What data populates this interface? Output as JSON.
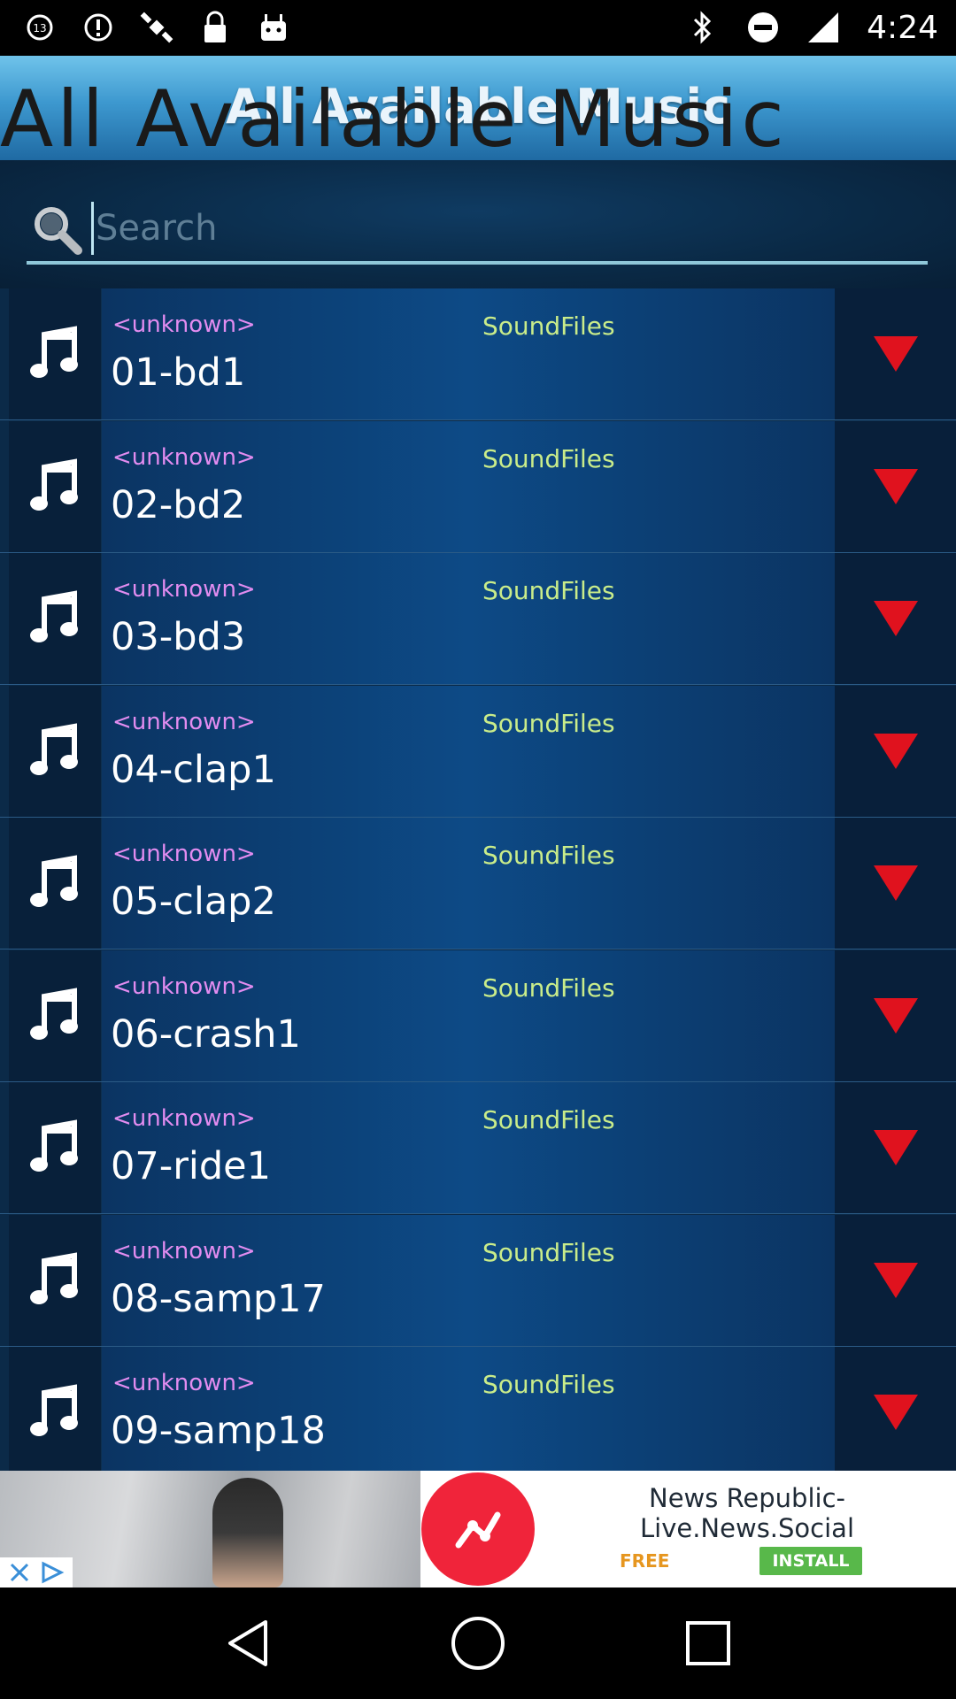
{
  "status_bar": {
    "time": "4:24",
    "left_icons": [
      "abc-13-news-icon",
      "alert-icon",
      "satellite-icon",
      "lock-icon",
      "android-icon"
    ],
    "right_icons": [
      "bluetooth-icon",
      "do-not-disturb-icon",
      "signal-icon"
    ]
  },
  "header": {
    "title": "All Available Music",
    "overlay_text": "All Available Music"
  },
  "search": {
    "placeholder": "Search",
    "value": ""
  },
  "tracks": [
    {
      "artist": "<unknown>",
      "folder": "SoundFiles",
      "title": "01-bd1"
    },
    {
      "artist": "<unknown>",
      "folder": "SoundFiles",
      "title": "02-bd2"
    },
    {
      "artist": "<unknown>",
      "folder": "SoundFiles",
      "title": "03-bd3"
    },
    {
      "artist": "<unknown>",
      "folder": "SoundFiles",
      "title": "04-clap1"
    },
    {
      "artist": "<unknown>",
      "folder": "SoundFiles",
      "title": "05-clap2"
    },
    {
      "artist": "<unknown>",
      "folder": "SoundFiles",
      "title": "06-crash1"
    },
    {
      "artist": "<unknown>",
      "folder": "SoundFiles",
      "title": "07-ride1"
    },
    {
      "artist": "<unknown>",
      "folder": "SoundFiles",
      "title": "08-samp17"
    },
    {
      "artist": "<unknown>",
      "folder": "SoundFiles",
      "title": "09-samp18"
    }
  ],
  "ad": {
    "title": "News Republic-\nLive.News.Social",
    "title_line1": "News Republic-",
    "title_line2": "Live.News.Social",
    "free_label": "FREE",
    "install_label": "INSTALL"
  },
  "colors": {
    "artist": "#e28cf0",
    "folder": "#c9ec8a",
    "title": "#ffffff",
    "menu_arrow": "#e0121e",
    "header_top": "#6fc3ea"
  }
}
